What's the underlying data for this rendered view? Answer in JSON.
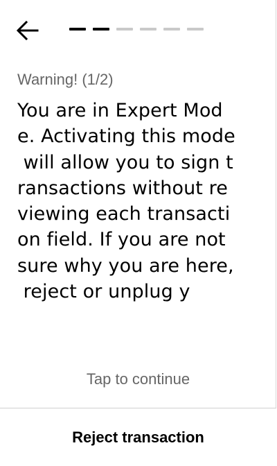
{
  "header": {
    "back_icon": "arrow-left-icon",
    "progress": {
      "current_step": 2,
      "total_steps": 6,
      "active_color": "#000000",
      "inactive_color": "#c9c9c9"
    }
  },
  "warning": {
    "title": "Warning! (1/2)",
    "lines": [
      "You are in Expert Mod",
      "e. Activating this mode",
      " will allow you to sign t",
      "ransactions without re",
      "viewing each transacti",
      "on field. If you are not",
      "sure why you are here,",
      " reject or unplug y"
    ]
  },
  "actions": {
    "tap_hint": "Tap to continue",
    "reject_label": "Reject transaction"
  },
  "colors": {
    "background": "#ffffff",
    "text_primary": "#000000",
    "text_secondary": "#666666",
    "divider": "#cfcfcf"
  }
}
